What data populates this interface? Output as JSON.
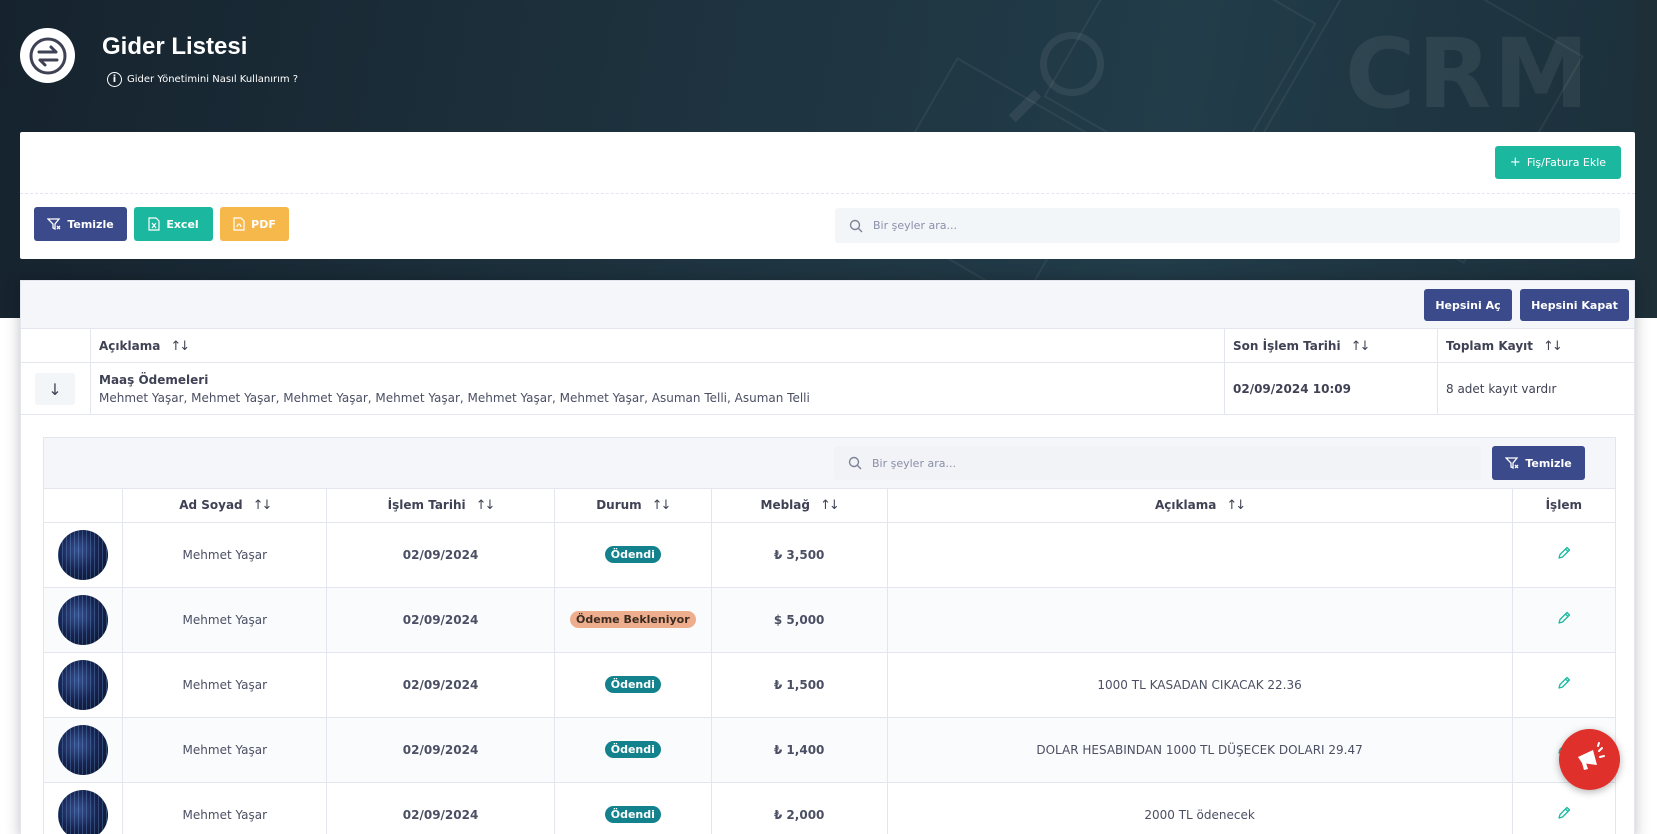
{
  "header": {
    "title": "Gider Listesi",
    "howto": "Gider Yönetimini Nasıl Kullanırım ?",
    "watermark": "CRM"
  },
  "top_card": {
    "add_button": "Fiş/Fatura Ekle",
    "clear_button": "Temizle",
    "excel_button": "Excel",
    "pdf_button": "PDF",
    "search_placeholder": "Bir şeyler ara..."
  },
  "group_table": {
    "expand_all": "Hepsini Aç",
    "collapse_all": "Hepsini Kapat",
    "columns": [
      "Açıklama",
      "Son İşlem Tarihi",
      "Toplam Kayıt"
    ],
    "row": {
      "title": "Maaş Ödemeleri",
      "names": "Mehmet Yaşar, Mehmet Yaşar, Mehmet Yaşar, Mehmet Yaşar, Mehmet Yaşar, Mehmet Yaşar, Asuman Telli, Asuman Telli",
      "last_date": "02/09/2024 10:09",
      "total": "8 adet kayıt vardır"
    }
  },
  "detail_table": {
    "search_placeholder": "Bir şeyler ara...",
    "clear_button": "Temizle",
    "columns": [
      "Ad Soyad",
      "İşlem Tarihi",
      "Durum",
      "Meblağ",
      "Açıklama",
      "İşlem"
    ],
    "rows": [
      {
        "name": "Mehmet Yaşar",
        "date": "02/09/2024",
        "status": "Ödendi",
        "amount": "₺ 3,500",
        "desc": ""
      },
      {
        "name": "Mehmet Yaşar",
        "date": "02/09/2024",
        "status": "Ödeme Bekleniyor",
        "amount": "$ 5,000",
        "desc": ""
      },
      {
        "name": "Mehmet Yaşar",
        "date": "02/09/2024",
        "status": "Ödendi",
        "amount": "₺ 1,500",
        "desc": "1000 TL KASADAN CIKACAK 22.36"
      },
      {
        "name": "Mehmet Yaşar",
        "date": "02/09/2024",
        "status": "Ödendi",
        "amount": "₺ 1,400",
        "desc": "DOLAR HESABINDAN 1000 TL DÜŞECEK DOLARI 29.47"
      },
      {
        "name": "Mehmet Yaşar",
        "date": "02/09/2024",
        "status": "Ödendi",
        "amount": "₺ 2,000",
        "desc": "2000 TL ödenecek"
      }
    ]
  },
  "colors": {
    "primary": "#3b4a8a",
    "success": "#1bb89f",
    "warning": "#f6b84b",
    "paid_badge": "#14828d",
    "pending_badge": "#eeae8e",
    "fab": "#e0302b"
  },
  "icons": [
    "exchange-icon",
    "info-icon",
    "plus-icon",
    "filter-clear-icon",
    "excel-file-icon",
    "pdf-file-icon",
    "search-icon",
    "sort-icon",
    "arrow-down-icon",
    "pencil-icon",
    "megaphone-icon"
  ]
}
